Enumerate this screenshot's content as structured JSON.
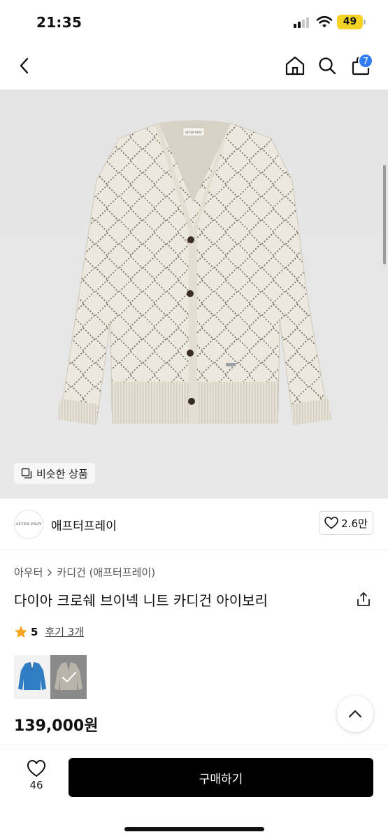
{
  "status": {
    "time": "21:35",
    "battery": "49"
  },
  "nav": {
    "cart_count": "7"
  },
  "image": {
    "similar_label": "비슷한 상품",
    "tag_text": "AFTER PRAY"
  },
  "brand": {
    "logo_text": "AFTER PRAY",
    "name": "애프터프레이",
    "likes": "2.6만"
  },
  "breadcrumb": {
    "category": "아우터",
    "subcategory": "카디건 (애프터프레이)"
  },
  "product": {
    "title": "다이아 크로쉐 브이넥 니트 카디건 아이보리",
    "rating": "5",
    "review_label": "후기 3개",
    "price": "139,000원"
  },
  "color_options": [
    {
      "name": "blue",
      "swatch": "#2f7dc2",
      "selected": false
    },
    {
      "name": "ivory",
      "swatch": "#e9e6dc",
      "selected": true
    }
  ],
  "bottom": {
    "wish_count": "46",
    "buy_label": "구매하기"
  },
  "colors": {
    "accent_badge": "#2f7cf6",
    "star": "#f5a623",
    "buy_button": "#000000"
  }
}
